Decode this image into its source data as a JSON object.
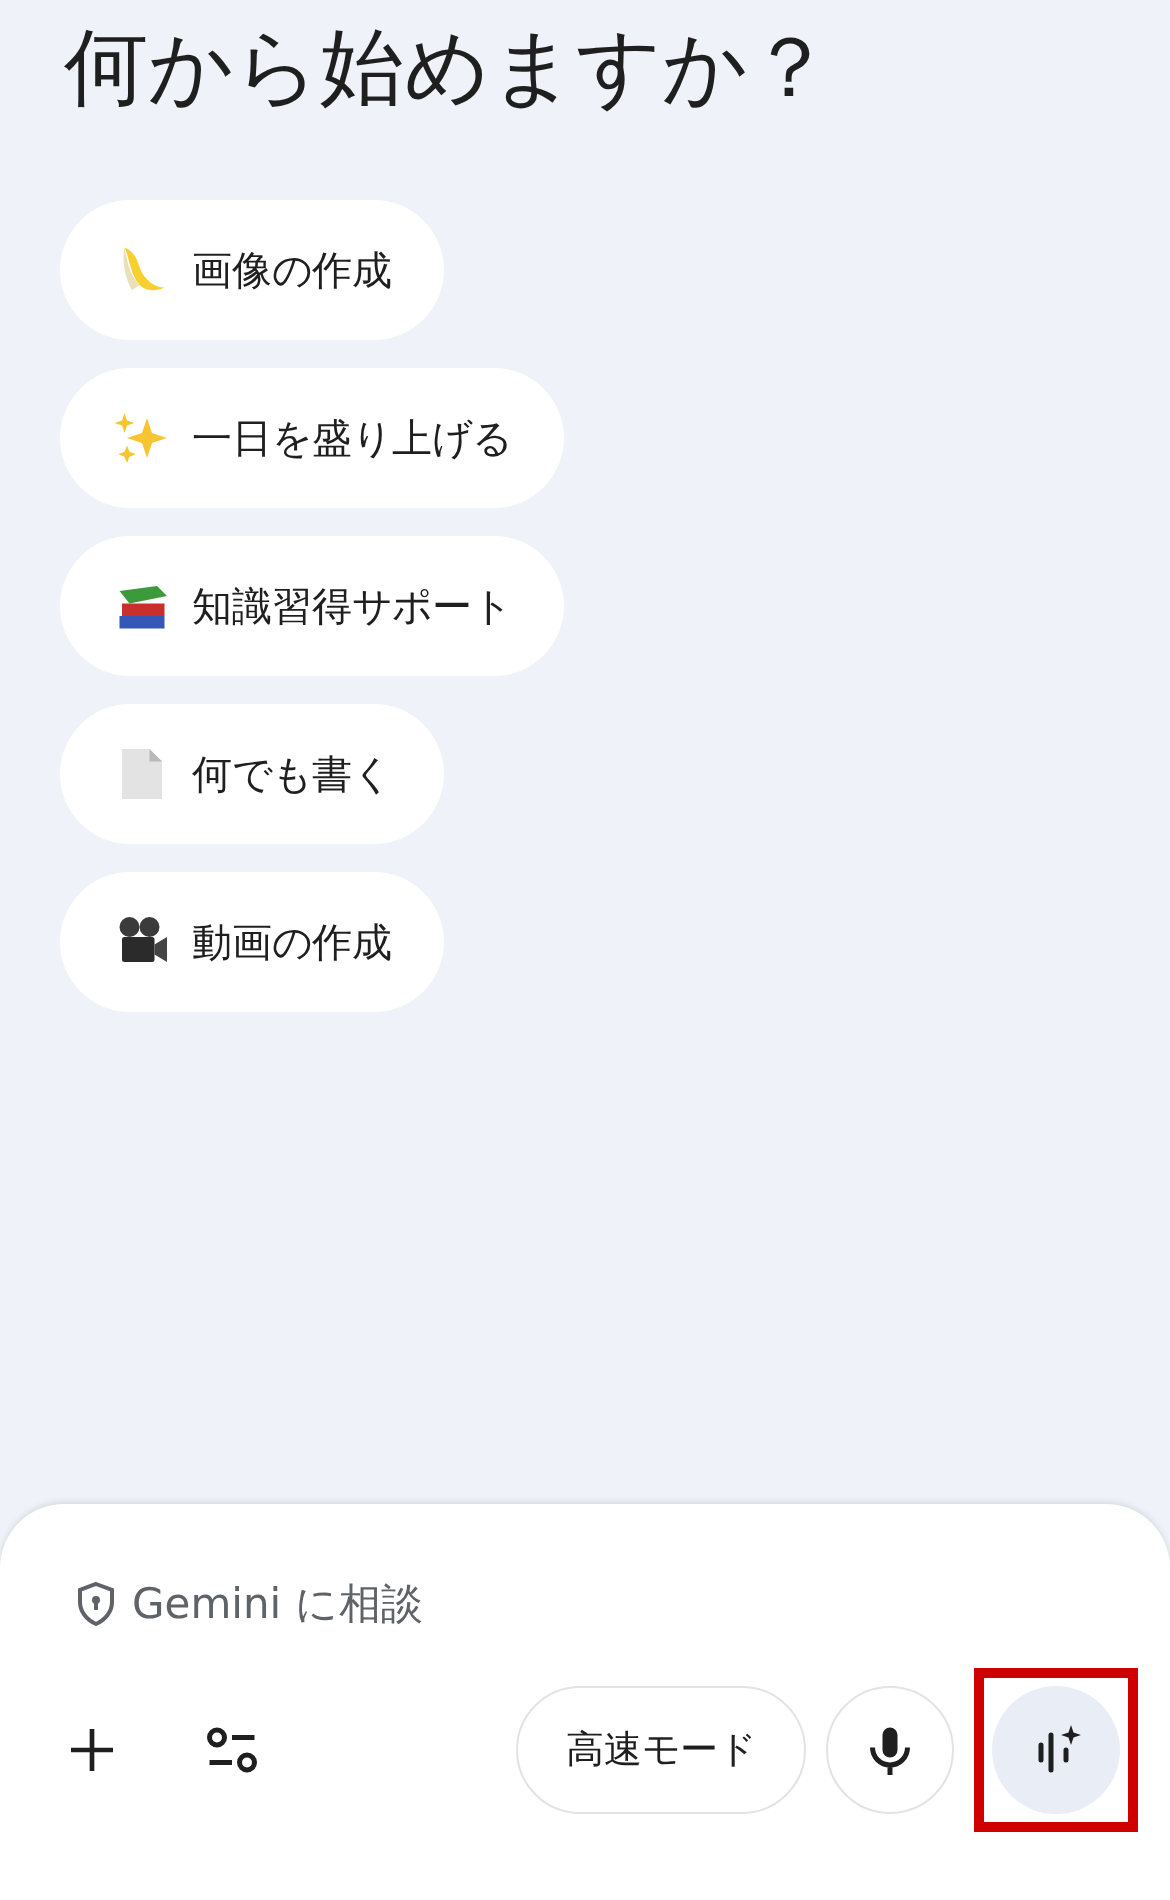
{
  "heading": "何から始めますか？",
  "suggestions": [
    {
      "kind": "banana",
      "label": "画像の作成"
    },
    {
      "kind": "sparkles",
      "label": "一日を盛り上げる"
    },
    {
      "kind": "books",
      "label": "知識習得サポート"
    },
    {
      "kind": "document",
      "label": "何でも書く"
    },
    {
      "kind": "camera",
      "label": "動画の作成"
    }
  ],
  "composer": {
    "placeholder": "Gemini に相談",
    "mode_button": "高速モード",
    "live_button_highlighted": true
  }
}
